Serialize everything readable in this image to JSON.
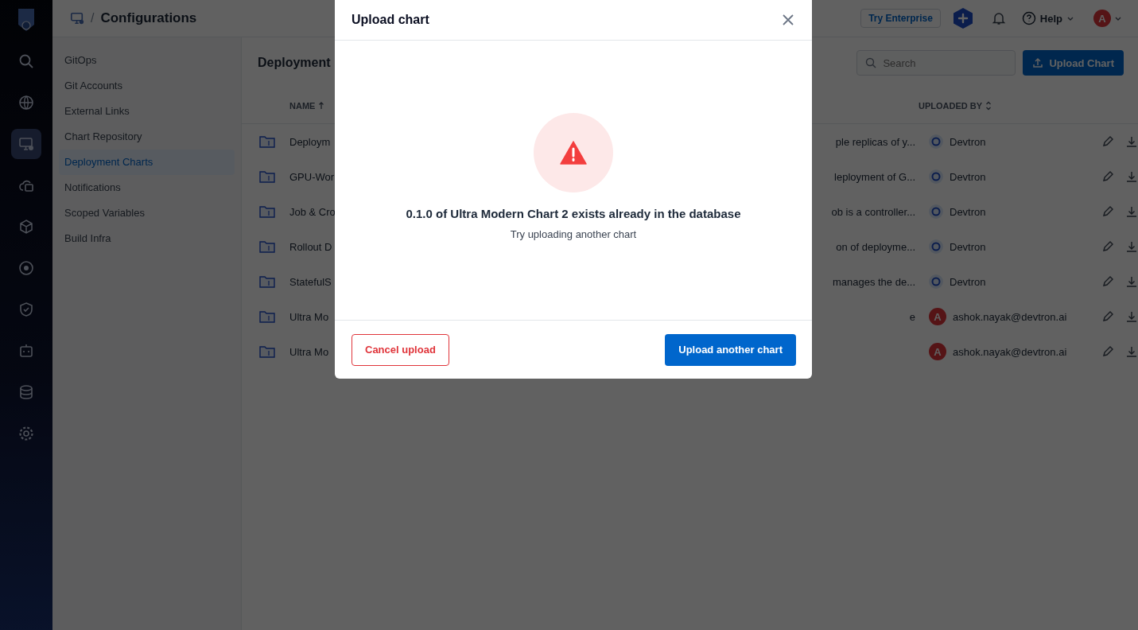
{
  "nav_rail": [
    {
      "kind": "logo",
      "selected": false
    },
    {
      "kind": "search",
      "selected": false
    },
    {
      "kind": "globe",
      "selected": false
    },
    {
      "kind": "monitor",
      "selected": true
    },
    {
      "kind": "cloud",
      "selected": false
    },
    {
      "kind": "cube",
      "selected": false
    },
    {
      "kind": "disk",
      "selected": false
    },
    {
      "kind": "shield",
      "selected": false
    },
    {
      "kind": "bot",
      "selected": false
    },
    {
      "kind": "database",
      "selected": false
    },
    {
      "kind": "gear",
      "selected": false
    }
  ],
  "header": {
    "separator": "/",
    "title": "Configurations",
    "try_enterprise": "Try Enterprise",
    "help": "Help",
    "avatar_initial": "A"
  },
  "sidebar": {
    "items": [
      {
        "label": "GitOps",
        "selected": false
      },
      {
        "label": "Git Accounts",
        "selected": false
      },
      {
        "label": "External Links",
        "selected": false
      },
      {
        "label": "Chart Repository",
        "selected": false
      },
      {
        "label": "Deployment Charts",
        "selected": true
      },
      {
        "label": "Notifications",
        "selected": false
      },
      {
        "label": "Scoped Variables",
        "selected": false
      },
      {
        "label": "Build Infra",
        "selected": false
      }
    ]
  },
  "content": {
    "title": "Deployment",
    "search": {
      "placeholder": "Search"
    },
    "upload_button": "Upload Chart",
    "columns": {
      "name": "NAME",
      "uploaded_by": "UPLOADED BY"
    },
    "rows": [
      {
        "name": "Deploym",
        "description": "ple replicas of y...",
        "uploader": "Devtron"
      },
      {
        "name": "GPU-Wor",
        "description": "leployment of G...",
        "uploader": "Devtron"
      },
      {
        "name": "Job & Cro",
        "description": "ob is a controller...",
        "uploader": "Devtron"
      },
      {
        "name": "Rollout D",
        "description": "on of deployme...",
        "uploader": "Devtron"
      },
      {
        "name": "StatefulS",
        "description": "manages the de...",
        "uploader": "Devtron"
      },
      {
        "name": "Ultra Mo",
        "description": "e",
        "uploader": "ashok.nayak@devtron.ai",
        "avatar_initial": "A"
      },
      {
        "name": "Ultra Mo",
        "uploader": "ashok.nayak@devtron.ai",
        "avatar_initial": "A"
      }
    ]
  },
  "modal": {
    "title": "Upload chart",
    "message": "0.1.0 of Ultra Modern Chart 2 exists already in the database",
    "hint": "Try uploading another chart",
    "cancel_button": "Cancel upload",
    "primary_button": "Upload another chart"
  }
}
